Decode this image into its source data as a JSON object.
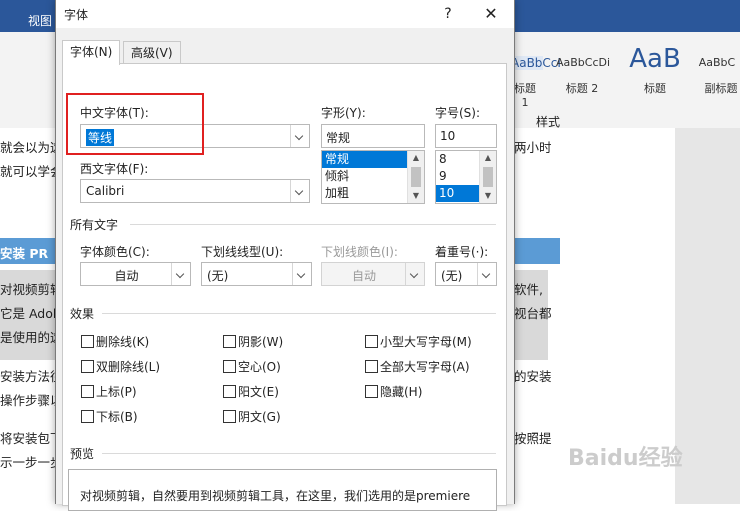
{
  "background": {
    "tab_view": "视图",
    "ribbon_styles": [
      "AaBbCcI",
      "AaBbCcDi",
      "AaB",
      "AaBbC"
    ],
    "ribbon_style_names": [
      "标题 1",
      "标题 2",
      "标题",
      "副标题"
    ],
    "styles_group_label": "样式",
    "doc_lines_left": [
      "就会以为这",
      "就可以学会",
      "安装 PR",
      "对视频剪辑",
      "它是 Adob",
      "是使用的这",
      "安装方法往",
      "操作步骤以",
      "将安装包下",
      "示一步一步"
    ],
    "doc_lines_right": [
      "两小时",
      "软件,",
      "视台都",
      "的安装",
      "按照提"
    ],
    "watermark": "Baidu经验"
  },
  "dialog": {
    "title": "字体",
    "help": "?",
    "close": "✕",
    "tabs": [
      "字体(N)",
      "高级(V)"
    ],
    "chinese_font_label": "中文字体(T):",
    "chinese_font_value": "等线",
    "western_font_label": "西文字体(F):",
    "western_font_value": "Calibri",
    "style_label": "字形(Y):",
    "style_value": "常规",
    "style_options": [
      "常规",
      "倾斜",
      "加粗"
    ],
    "size_label": "字号(S):",
    "size_value": "10",
    "size_options": [
      "8",
      "9",
      "10"
    ],
    "all_text_section": "所有文字",
    "font_color_label": "字体颜色(C):",
    "font_color_value": "自动",
    "underline_style_label": "下划线线型(U):",
    "underline_style_value": "(无)",
    "underline_color_label": "下划线颜色(I):",
    "underline_color_value": "自动",
    "emphasis_label": "着重号(·):",
    "emphasis_value": "(无)",
    "effects_section": "效果",
    "effects": [
      "删除线(K)",
      "阴影(W)",
      "小型大写字母(M)",
      "双删除线(L)",
      "空心(O)",
      "全部大写字母(A)",
      "上标(P)",
      "阳文(E)",
      "隐藏(H)",
      "下标(B)",
      "阴文(G)"
    ],
    "preview_section": "预览",
    "preview_text": "对视频剪辑，自然要用到视频剪辑工具，在这里，我们选用的是premiere"
  },
  "colors": {
    "selection": "#0078d7",
    "highlight_box": "#e02020",
    "word_blue": "#2b579a"
  }
}
